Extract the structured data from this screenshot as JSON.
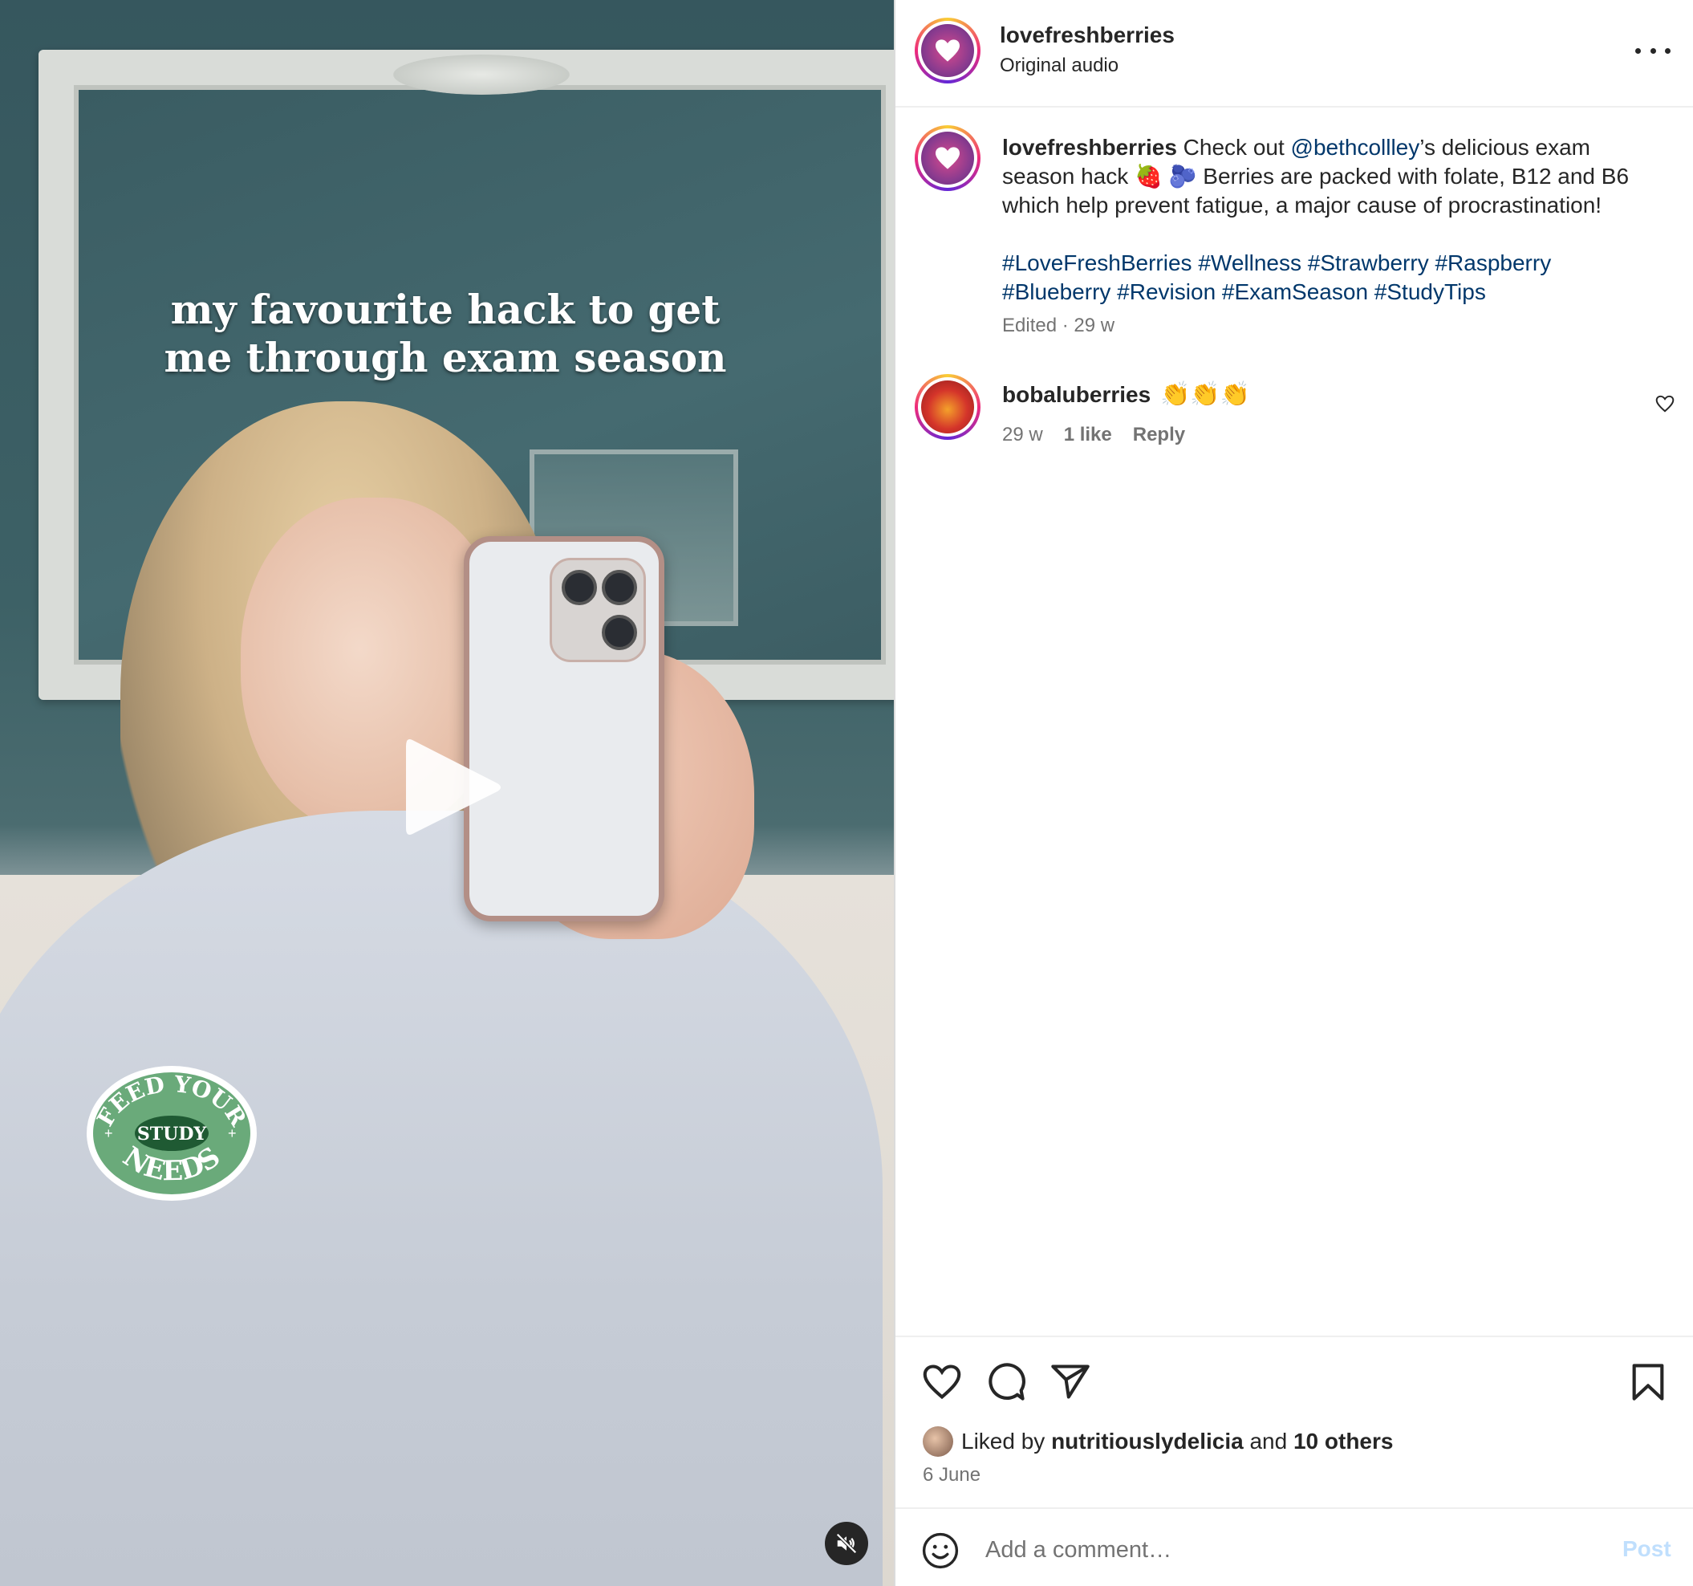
{
  "video": {
    "overlay_line1": "my favourite hack to get",
    "overlay_line2": "me through exam season",
    "sticker": {
      "top": "FEED YOUR",
      "middle": "STUDY",
      "bottom": "NEEDS",
      "color": "#6aaa7a"
    },
    "play_icon": "play-icon",
    "mute_icon": "muted-speaker-icon"
  },
  "header": {
    "username": "lovefreshberries",
    "audio": "Original audio",
    "more_icon": "more-options-icon"
  },
  "caption": {
    "username": "lovefreshberries",
    "text_before_mention": "Check out",
    "mention": "@bethcollley",
    "text_after_mention": "’s delicious exam season hack 🍓 🫐 Berries are packed with folate, B12 and B6 which help prevent fatigue, a major cause of procrastination!",
    "hashtags": "#LoveFreshBerries #Wellness #Strawberry #Raspberry #Blueberry #Revision #ExamSeason #StudyTips",
    "meta": "Edited · 29 w"
  },
  "comments": [
    {
      "username": "bobaluberries",
      "text": "👏👏👏",
      "age": "29 w",
      "likes": "1 like",
      "reply": "Reply"
    }
  ],
  "actions": {
    "icons": [
      "heart-icon",
      "comment-icon",
      "share-icon",
      "bookmark-icon"
    ],
    "liked_by_prefix": "Liked by",
    "liked_by_user": "nutritiouslydelicia",
    "liked_by_and": "and",
    "liked_by_others": "10 others",
    "date": "6 June"
  },
  "add_comment": {
    "placeholder": "Add a comment…",
    "post_label": "Post"
  },
  "colors": {
    "link": "#00376b",
    "meta_text": "#737373",
    "post_disabled": "#c0dffd"
  }
}
